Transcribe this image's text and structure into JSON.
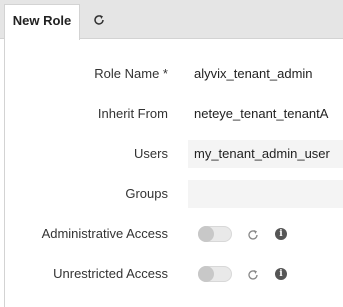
{
  "tabs": [
    {
      "label": "New Role",
      "active": true
    },
    {
      "icon": "refresh-icon"
    }
  ],
  "form": {
    "role_name": {
      "label": "Role Name *",
      "value": "alyvix_tenant_admin"
    },
    "inherit_from": {
      "label": "Inherit From",
      "value": "neteye_tenant_tenantA"
    },
    "users": {
      "label": "Users",
      "value": "my_tenant_admin_user"
    },
    "groups": {
      "label": "Groups",
      "value": ""
    },
    "administrative_access": {
      "label": "Administrative Access",
      "enabled": false
    },
    "unrestricted_access": {
      "label": "Unrestricted Access",
      "enabled": false
    }
  },
  "colors": {
    "tabbar_bg": "#e5e5e5",
    "field_bg": "#f4f4f4",
    "toggle_off": "#c8c8c8"
  }
}
